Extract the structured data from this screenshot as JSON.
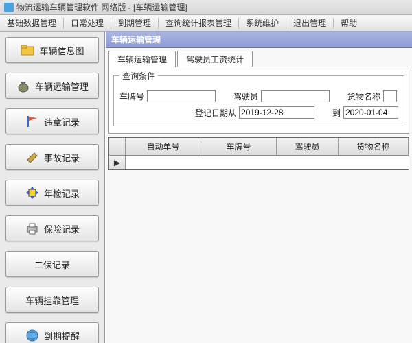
{
  "window": {
    "title": "物流运输车辆管理软件    网络版 - [车辆运输管理]"
  },
  "menu": {
    "items": [
      "基础数据管理",
      "日常处理",
      "到期管理",
      "查询统计报表管理",
      "系统维护",
      "退出管理",
      "帮助"
    ]
  },
  "sidebar": {
    "items": [
      {
        "label": "车辆信息图",
        "icon": "folder-icon"
      },
      {
        "label": "车辆运输管理",
        "icon": "money-bag-icon"
      },
      {
        "label": "违章记录",
        "icon": "flag-icon"
      },
      {
        "label": "事故记录",
        "icon": "wrench-icon"
      },
      {
        "label": "年检记录",
        "icon": "arrows-icon"
      },
      {
        "label": "保险记录",
        "icon": "printer-icon"
      },
      {
        "label": "二保记录",
        "icon": ""
      },
      {
        "label": "车辆挂靠管理",
        "icon": ""
      },
      {
        "label": "到期提醒",
        "icon": "globe-icon"
      }
    ]
  },
  "page": {
    "title": "车辆运输管理",
    "tabs": [
      "车辆运输管理",
      "驾驶员工资统计"
    ],
    "query": {
      "legend": "查询条件",
      "plate_label": "车牌号",
      "driver_label": "驾驶员",
      "cargo_label": "货物名称",
      "date_from_label": "登记日期从",
      "date_from": "2019-12-28",
      "date_to_label": "到",
      "date_to": "2020-01-04"
    },
    "grid": {
      "cols": [
        "自动单号",
        "车牌号",
        "驾驶员",
        "货物名称"
      ]
    }
  }
}
